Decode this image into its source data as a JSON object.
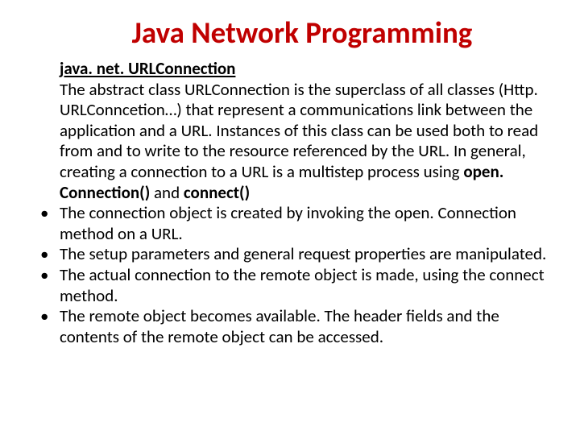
{
  "title": "Java Network Programming",
  "heading": "java. net. URLConnection",
  "intro_part1": "The abstract class URLConnection is the superclass of all classes (Http. URLConncetion…) that represent a communications link between the application and a URL. Instances of this class can be used both to read from and to write to the resource referenced by the URL. In general, creating a connection to a URL is a multistep process using  ",
  "intro_bold1": "open. Connection()",
  "intro_mid": " and ",
  "intro_bold2": "connect()",
  "bullets": [
    "The connection object is created by invoking the open. Connection method on a URL.",
    "The setup parameters and general request properties are manipulated.",
    "The actual connection to the remote object is made, using the connect method.",
    "The remote object becomes available. The header fields and the contents of the remote object can be accessed."
  ]
}
